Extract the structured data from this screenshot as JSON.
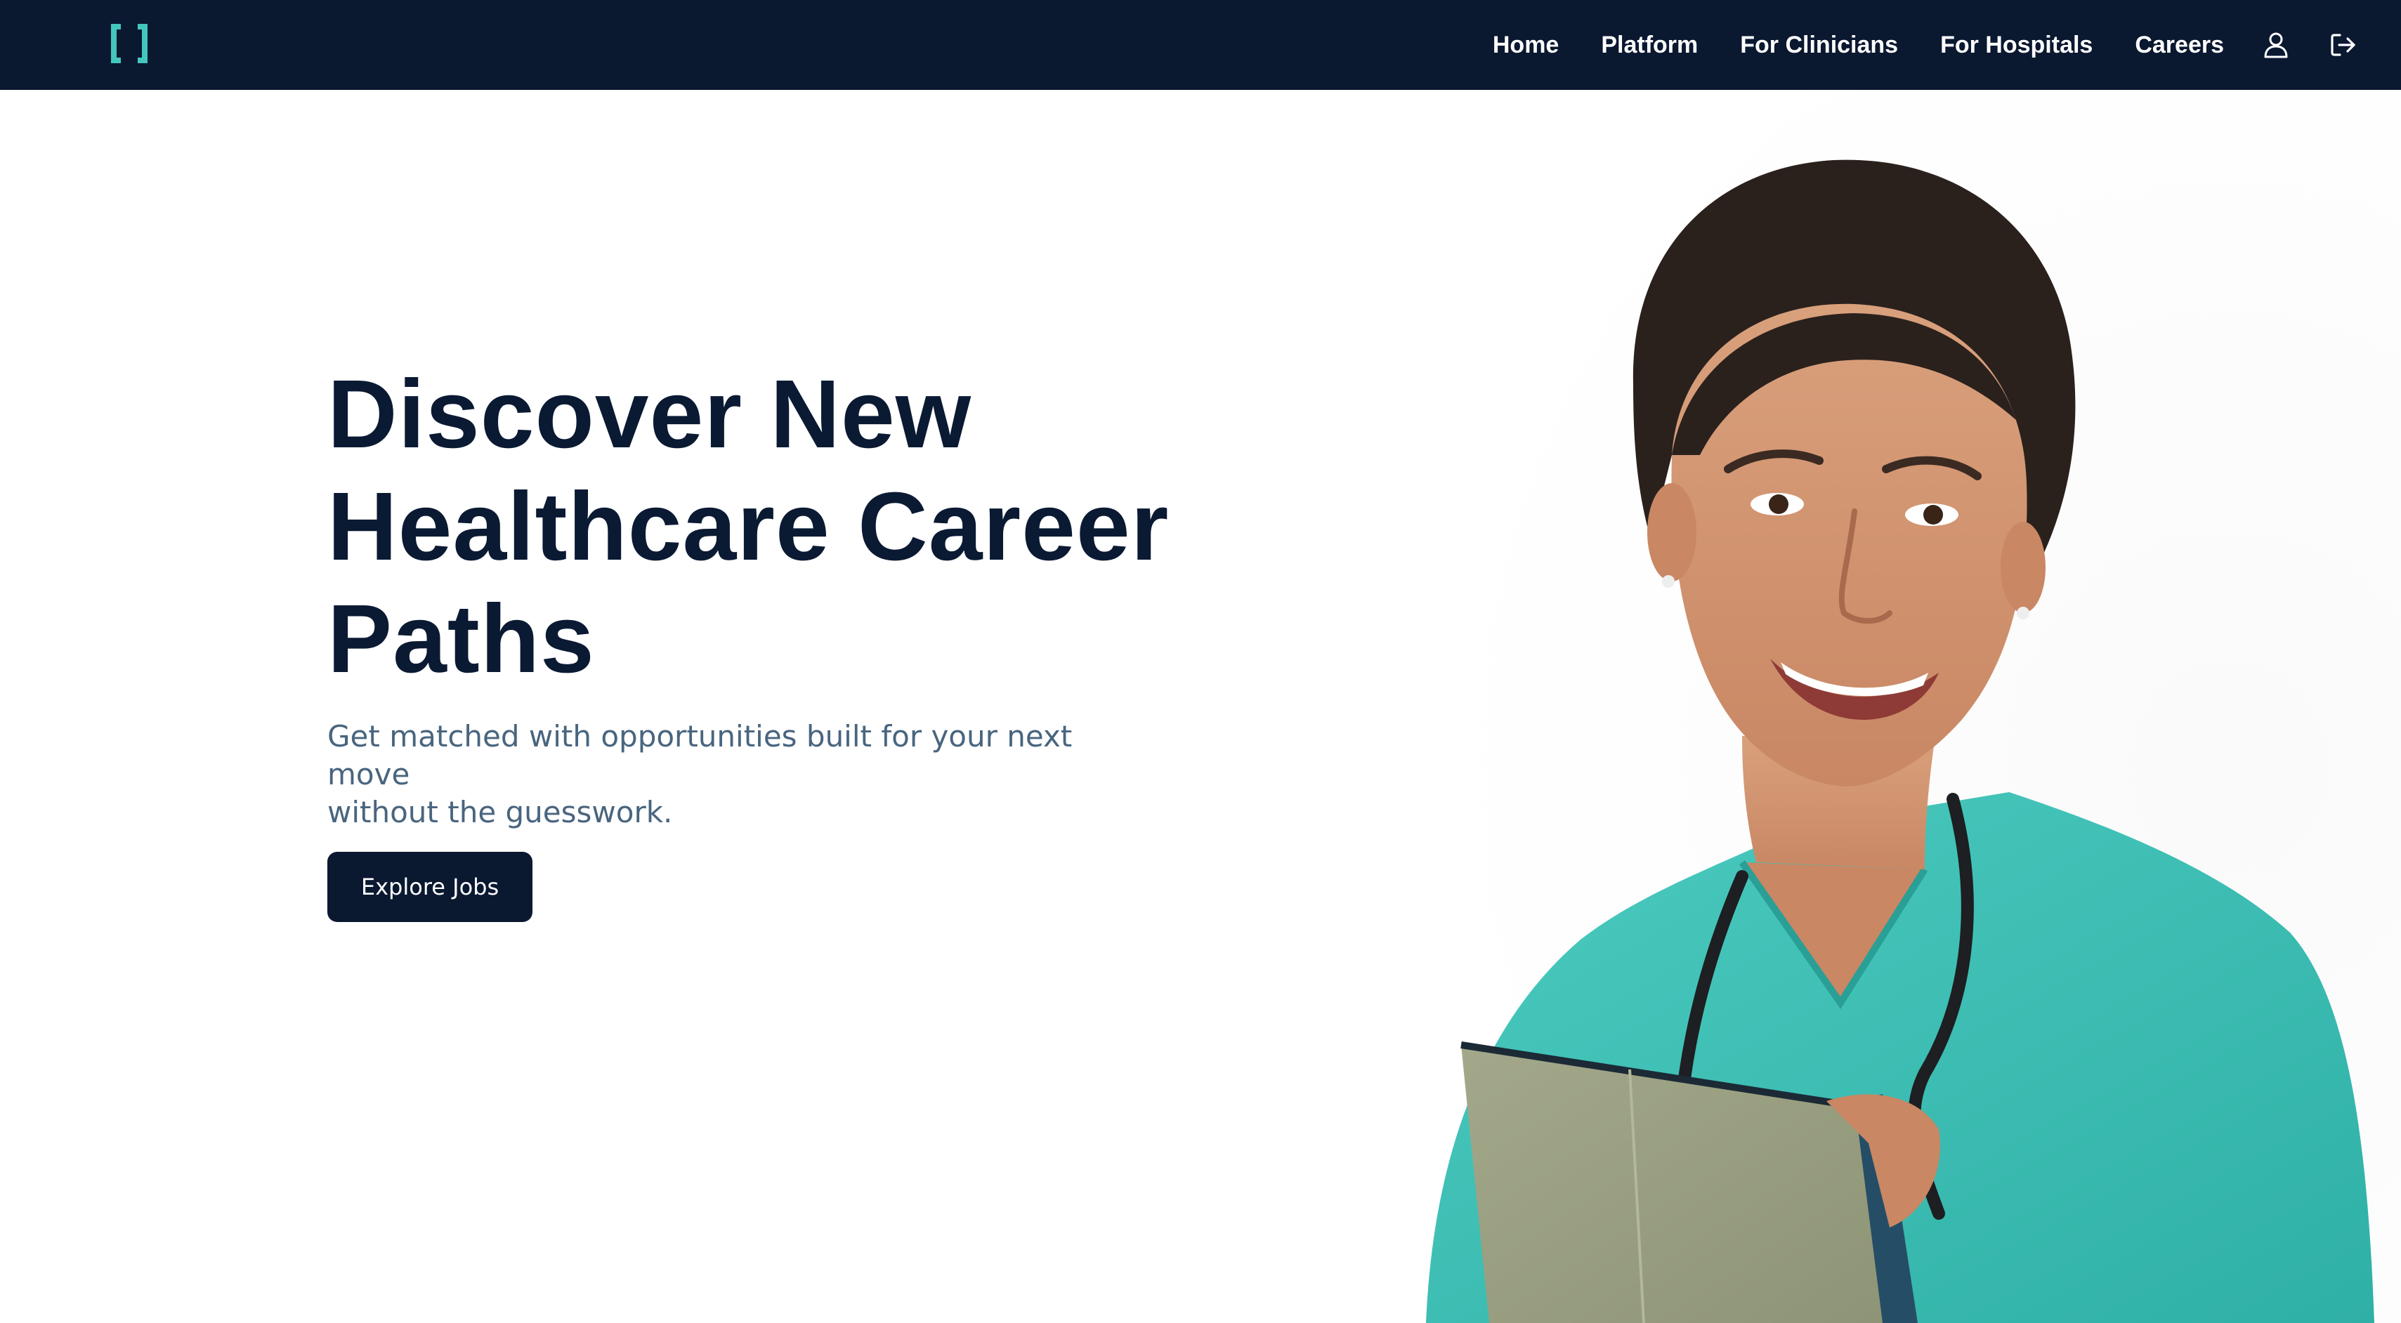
{
  "nav": {
    "logo_icon": "bracket-logo-icon",
    "links": [
      "Home",
      "Platform",
      "For Clinicians",
      "For Hospitals",
      "Careers"
    ],
    "account_icon": "user-icon",
    "logout_icon": "sign-out-icon"
  },
  "hero": {
    "title_lines": [
      "Discover New",
      "Healthcare Career",
      "Paths"
    ],
    "subtitle_lines": [
      "Get matched with opportunities built for your next move",
      "without the guesswork."
    ],
    "cta_label": "Explore Jobs",
    "image_subject": "smiling healthcare worker in teal scrubs with stethoscope holding folder"
  },
  "colors": {
    "navy": "#0a1830",
    "teal_accent": "#43c6bd",
    "subtitle": "#49657f",
    "scrubs": "#3fc3b8"
  }
}
